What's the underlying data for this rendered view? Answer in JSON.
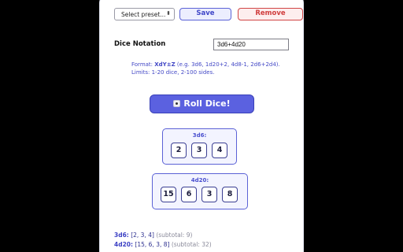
{
  "toolbar": {
    "preset_selected": "Select preset...",
    "save_label": "Save",
    "remove_label": "Remove"
  },
  "notation": {
    "label": "Dice Notation",
    "value": "3d6+4d20"
  },
  "hint": {
    "format_prefix": "Format: ",
    "format_code": "XdY±Z",
    "format_examples": " (e.g. 3d6, 1d20+2, 4d8-1, 2d6+2d4).",
    "limits": "Limits: 1-20 dice, 2-100 sides."
  },
  "roll_button": {
    "label": "Roll Dice!",
    "icon": "die-icon"
  },
  "groups": [
    {
      "label": "3d6:",
      "dice": [
        "2",
        "3",
        "4"
      ]
    },
    {
      "label": "4d20:",
      "dice": [
        "15",
        "6",
        "3",
        "8"
      ]
    }
  ],
  "results": [
    {
      "name": "3d6:",
      "values": "[2, 3, 4]",
      "subtotal": "(subtotal: 9)"
    },
    {
      "name": "4d20:",
      "values": "[15, 6, 3, 8]",
      "subtotal": "(subtotal: 32)"
    }
  ],
  "colors": {
    "accent": "#5b61e0",
    "remove": "#d03d3d",
    "background": "#000000"
  }
}
